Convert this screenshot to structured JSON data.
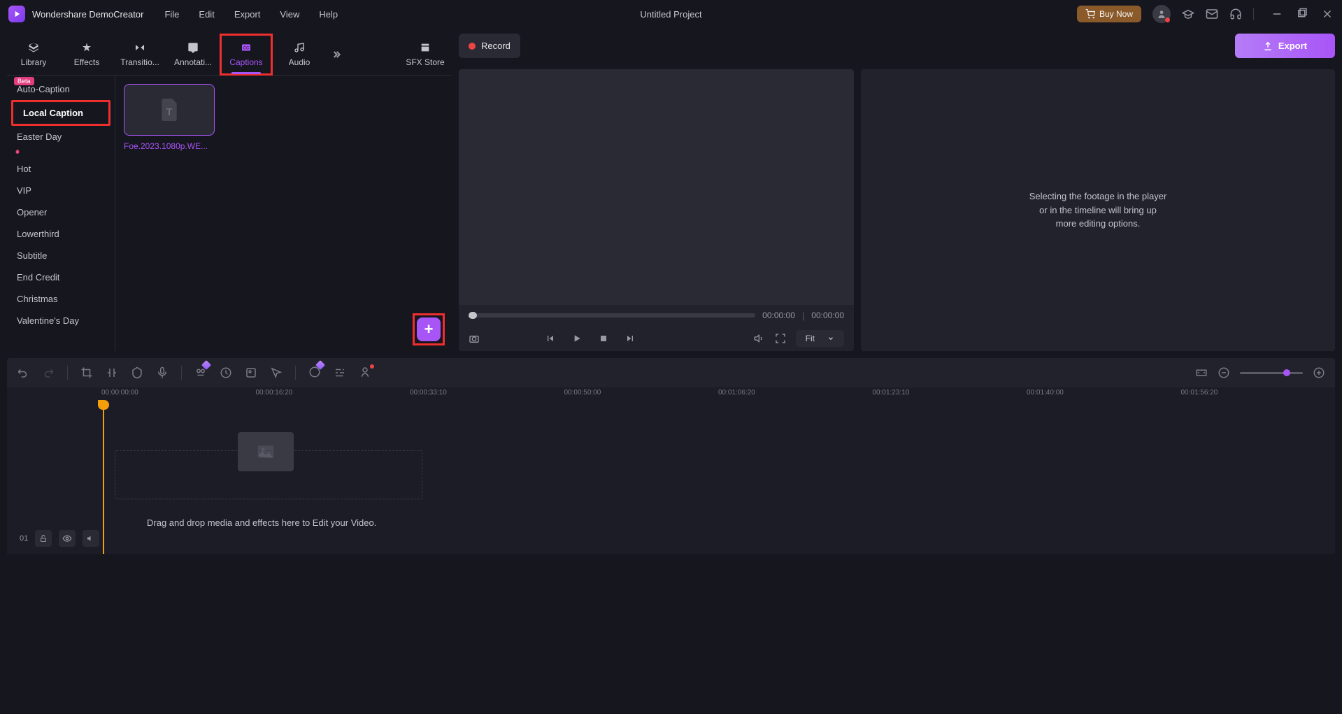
{
  "app_title": "Wondershare DemoCreator",
  "menubar": [
    "File",
    "Edit",
    "Export",
    "View",
    "Help"
  ],
  "project_title": "Untitled Project",
  "buy_now": "Buy Now",
  "tabs": [
    {
      "label": "Library"
    },
    {
      "label": "Effects"
    },
    {
      "label": "Transitio..."
    },
    {
      "label": "Annotati..."
    },
    {
      "label": "Captions"
    },
    {
      "label": "Audio"
    },
    {
      "label": "SFX Store"
    }
  ],
  "sidebar": {
    "beta_badge": "Beta",
    "items": [
      {
        "label": "Auto-Caption"
      },
      {
        "label": "Local Caption"
      },
      {
        "label": "Easter Day"
      },
      {
        "label": "Hot"
      },
      {
        "label": "VIP"
      },
      {
        "label": "Opener"
      },
      {
        "label": "Lowerthird"
      },
      {
        "label": "Subtitle"
      },
      {
        "label": "End Credit"
      },
      {
        "label": "Christmas"
      },
      {
        "label": "Valentine's Day"
      }
    ]
  },
  "caption_item_name": "Foe.2023.1080p.WE...",
  "record_label": "Record",
  "export_label": "Export",
  "time_current": "00:00:00",
  "time_total": "00:00:00",
  "fit_label": "Fit",
  "inspector_text": "Selecting the footage in the player or in the timeline will bring up more editing options.",
  "ruler_times": [
    "00:00:00:00",
    "00:00:16:20",
    "00:00:33:10",
    "00:00:50:00",
    "00:01:06:20",
    "00:01:23:10",
    "00:01:40:00",
    "00:01:56:20"
  ],
  "drop_hint": "Drag and drop media and effects here to Edit your Video.",
  "lane_number": "01"
}
